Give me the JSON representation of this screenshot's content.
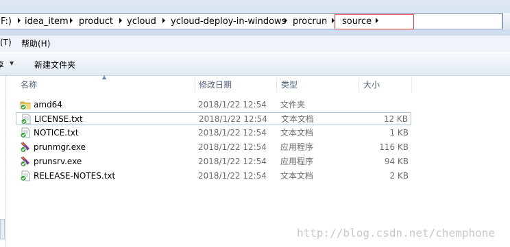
{
  "address_bar": {
    "crumbs": [
      "F:)",
      "idea_item",
      "product",
      "ycloud",
      "ycloud-deploy-in-windows",
      "procrun",
      "source"
    ]
  },
  "menu": {
    "items": [
      "(T)",
      "帮助(H)"
    ]
  },
  "command_bar": {
    "left_partial": "享",
    "new_folder": "新建文件夹"
  },
  "columns": {
    "name": "名称",
    "modified": "修改日期",
    "type": "类型",
    "size": "大小"
  },
  "files": [
    {
      "name": "amd64",
      "modified": "2018/1/22 12:54",
      "type": "文件夹",
      "size": "",
      "icon": "folder-icon"
    },
    {
      "name": "LICENSE.txt",
      "modified": "2018/1/22 12:54",
      "type": "文本文档",
      "size": "12 KB",
      "icon": "text-file-icon"
    },
    {
      "name": "NOTICE.txt",
      "modified": "2018/1/22 12:54",
      "type": "文本文档",
      "size": "1 KB",
      "icon": "text-file-icon"
    },
    {
      "name": "prunmgr.exe",
      "modified": "2018/1/22 12:54",
      "type": "应用程序",
      "size": "116 KB",
      "icon": "exe-icon"
    },
    {
      "name": "prunsrv.exe",
      "modified": "2018/1/22 12:54",
      "type": "应用程序",
      "size": "94 KB",
      "icon": "exe-icon"
    },
    {
      "name": "RELEASE-NOTES.txt",
      "modified": "2018/1/22 12:54",
      "type": "文本文档",
      "size": "2 KB",
      "icon": "text-file-icon"
    }
  ],
  "watermark": "http://blog.csdn.net/chemphone",
  "colors": {
    "highlight_border": "#e8353c",
    "selected_row_border": "#aac8e8",
    "sync_badge": "#3aa53a"
  }
}
